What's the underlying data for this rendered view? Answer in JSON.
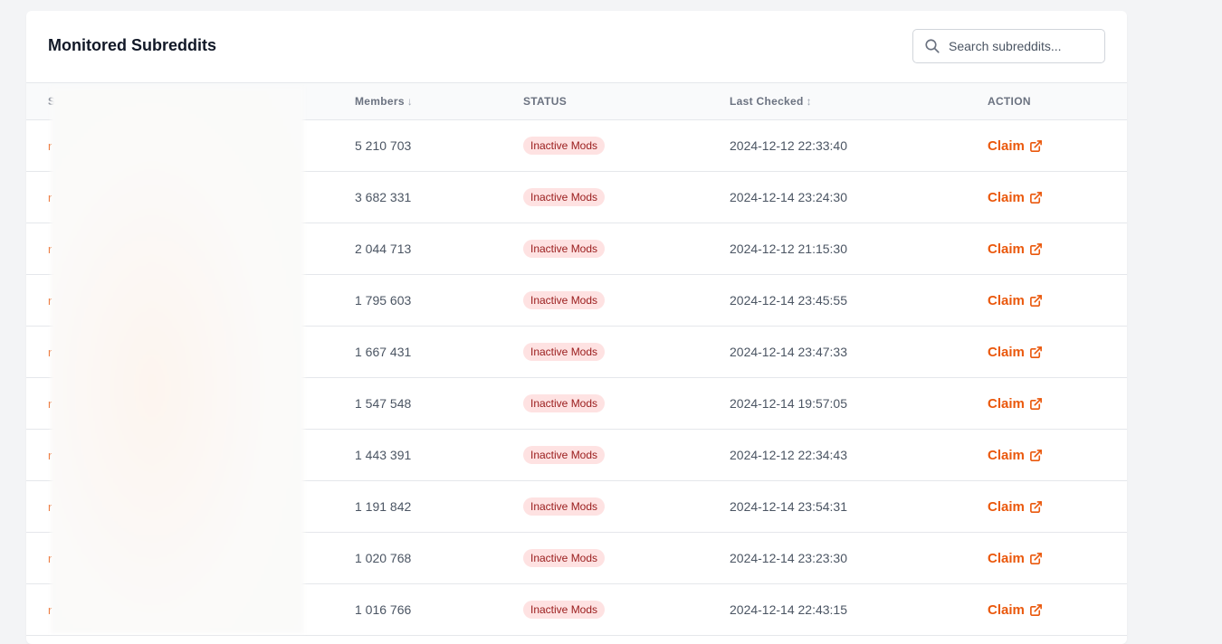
{
  "header": {
    "title": "Monitored Subreddits",
    "search_placeholder": "Search subreddits..."
  },
  "table": {
    "columns": {
      "subreddit": "S",
      "members": "Members",
      "members_sort": "↓",
      "status": "STATUS",
      "last_checked": "Last Checked",
      "last_checked_sort": "↕",
      "action": "ACTION"
    },
    "rows": [
      {
        "name": "r",
        "members": "5 210 703",
        "status": "Inactive Mods",
        "last_checked": "2024-12-12 22:33:40",
        "action": "Claim"
      },
      {
        "name": "r",
        "members": "3 682 331",
        "status": "Inactive Mods",
        "last_checked": "2024-12-14 23:24:30",
        "action": "Claim"
      },
      {
        "name": "r",
        "members": "2 044 713",
        "status": "Inactive Mods",
        "last_checked": "2024-12-12 21:15:30",
        "action": "Claim"
      },
      {
        "name": "r",
        "members": "1 795 603",
        "status": "Inactive Mods",
        "last_checked": "2024-12-14 23:45:55",
        "action": "Claim"
      },
      {
        "name": "r",
        "members": "1 667 431",
        "status": "Inactive Mods",
        "last_checked": "2024-12-14 23:47:33",
        "action": "Claim"
      },
      {
        "name": "r",
        "members": "1 547 548",
        "status": "Inactive Mods",
        "last_checked": "2024-12-14 19:57:05",
        "action": "Claim"
      },
      {
        "name": "r",
        "members": "1 443 391",
        "status": "Inactive Mods",
        "last_checked": "2024-12-12 22:34:43",
        "action": "Claim"
      },
      {
        "name": "r",
        "members": "1 191 842",
        "status": "Inactive Mods",
        "last_checked": "2024-12-14 23:54:31",
        "action": "Claim"
      },
      {
        "name": "r",
        "members": "1 020 768",
        "status": "Inactive Mods",
        "last_checked": "2024-12-14 23:23:30",
        "action": "Claim"
      },
      {
        "name": "r",
        "members": "1 016 766",
        "status": "Inactive Mods",
        "last_checked": "2024-12-14 22:43:15",
        "action": "Claim"
      }
    ]
  },
  "icons": {
    "search": "search-icon",
    "external": "external-link-icon"
  },
  "colors": {
    "accent": "#ea580c",
    "badge_bg": "#fee2e2",
    "badge_text": "#991b1b",
    "page_bg": "#f3f4f6"
  }
}
